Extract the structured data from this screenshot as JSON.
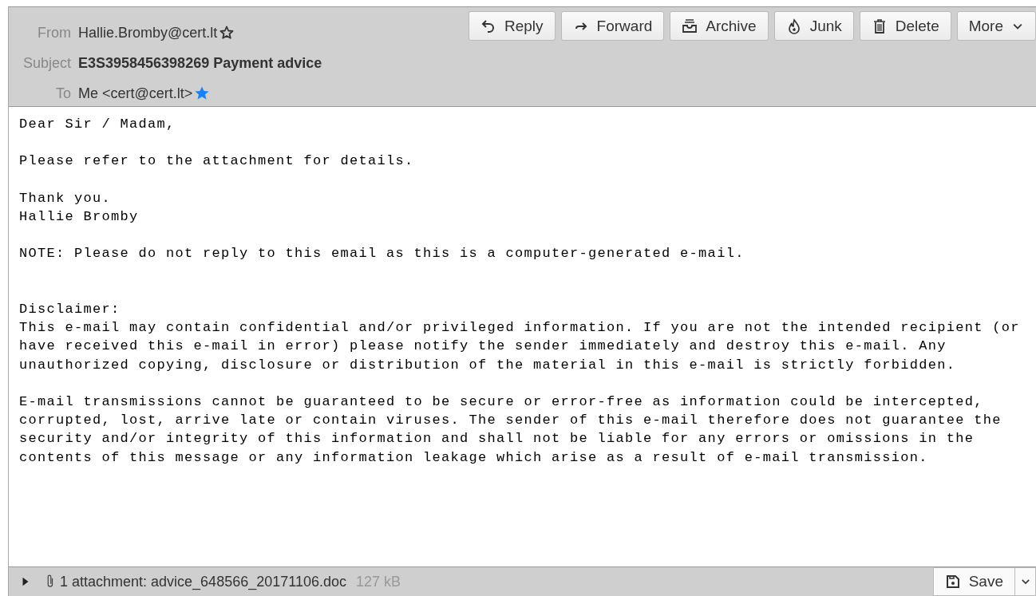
{
  "header": {
    "fields": [
      {
        "label": "From",
        "value": "Hallie.Bromby@cert.lt",
        "bold": false,
        "starred": false
      },
      {
        "label": "Subject",
        "value": "E3S3958456398269 Payment advice",
        "bold": true
      },
      {
        "label": "To",
        "value": "Me <cert@cert.lt>",
        "bold": false,
        "starred": true
      }
    ],
    "buttons": [
      {
        "kind": "reply",
        "label": "Reply"
      },
      {
        "kind": "forward",
        "label": "Forward"
      },
      {
        "kind": "archive",
        "label": "Archive"
      },
      {
        "kind": "junk",
        "label": "Junk"
      },
      {
        "kind": "delete",
        "label": "Delete"
      },
      {
        "kind": "more",
        "label": "More"
      }
    ]
  },
  "body": "Dear Sir / Madam,\n\nPlease refer to the attachment for details.\n\nThank you.\nHallie Bromby\n\nNOTE: Please do not reply to this email as this is a computer-generated e-mail.\n\n\nDisclaimer:\nThis e-mail may contain confidential and/or privileged information. If you are not the intended recipient (or\nhave received this e-mail in error) please notify the sender immediately and destroy this e-mail. Any\nunauthorized copying, disclosure or distribution of the material in this e-mail is strictly forbidden.\n\nE-mail transmissions cannot be guaranteed to be secure or error-free as information could be intercepted,\ncorrupted, lost, arrive late or contain viruses. The sender of this e-mail therefore does not guarantee the\nsecurity and/or integrity of this information and shall not be liable for any errors or omissions in the\ncontents of this message or any information leakage which arise as a result of e-mail transmission.",
  "attachments": {
    "expanded": false,
    "summary": "1 attachment: advice_648566_20171106.doc",
    "size": "127 kB",
    "save_label": "Save"
  }
}
